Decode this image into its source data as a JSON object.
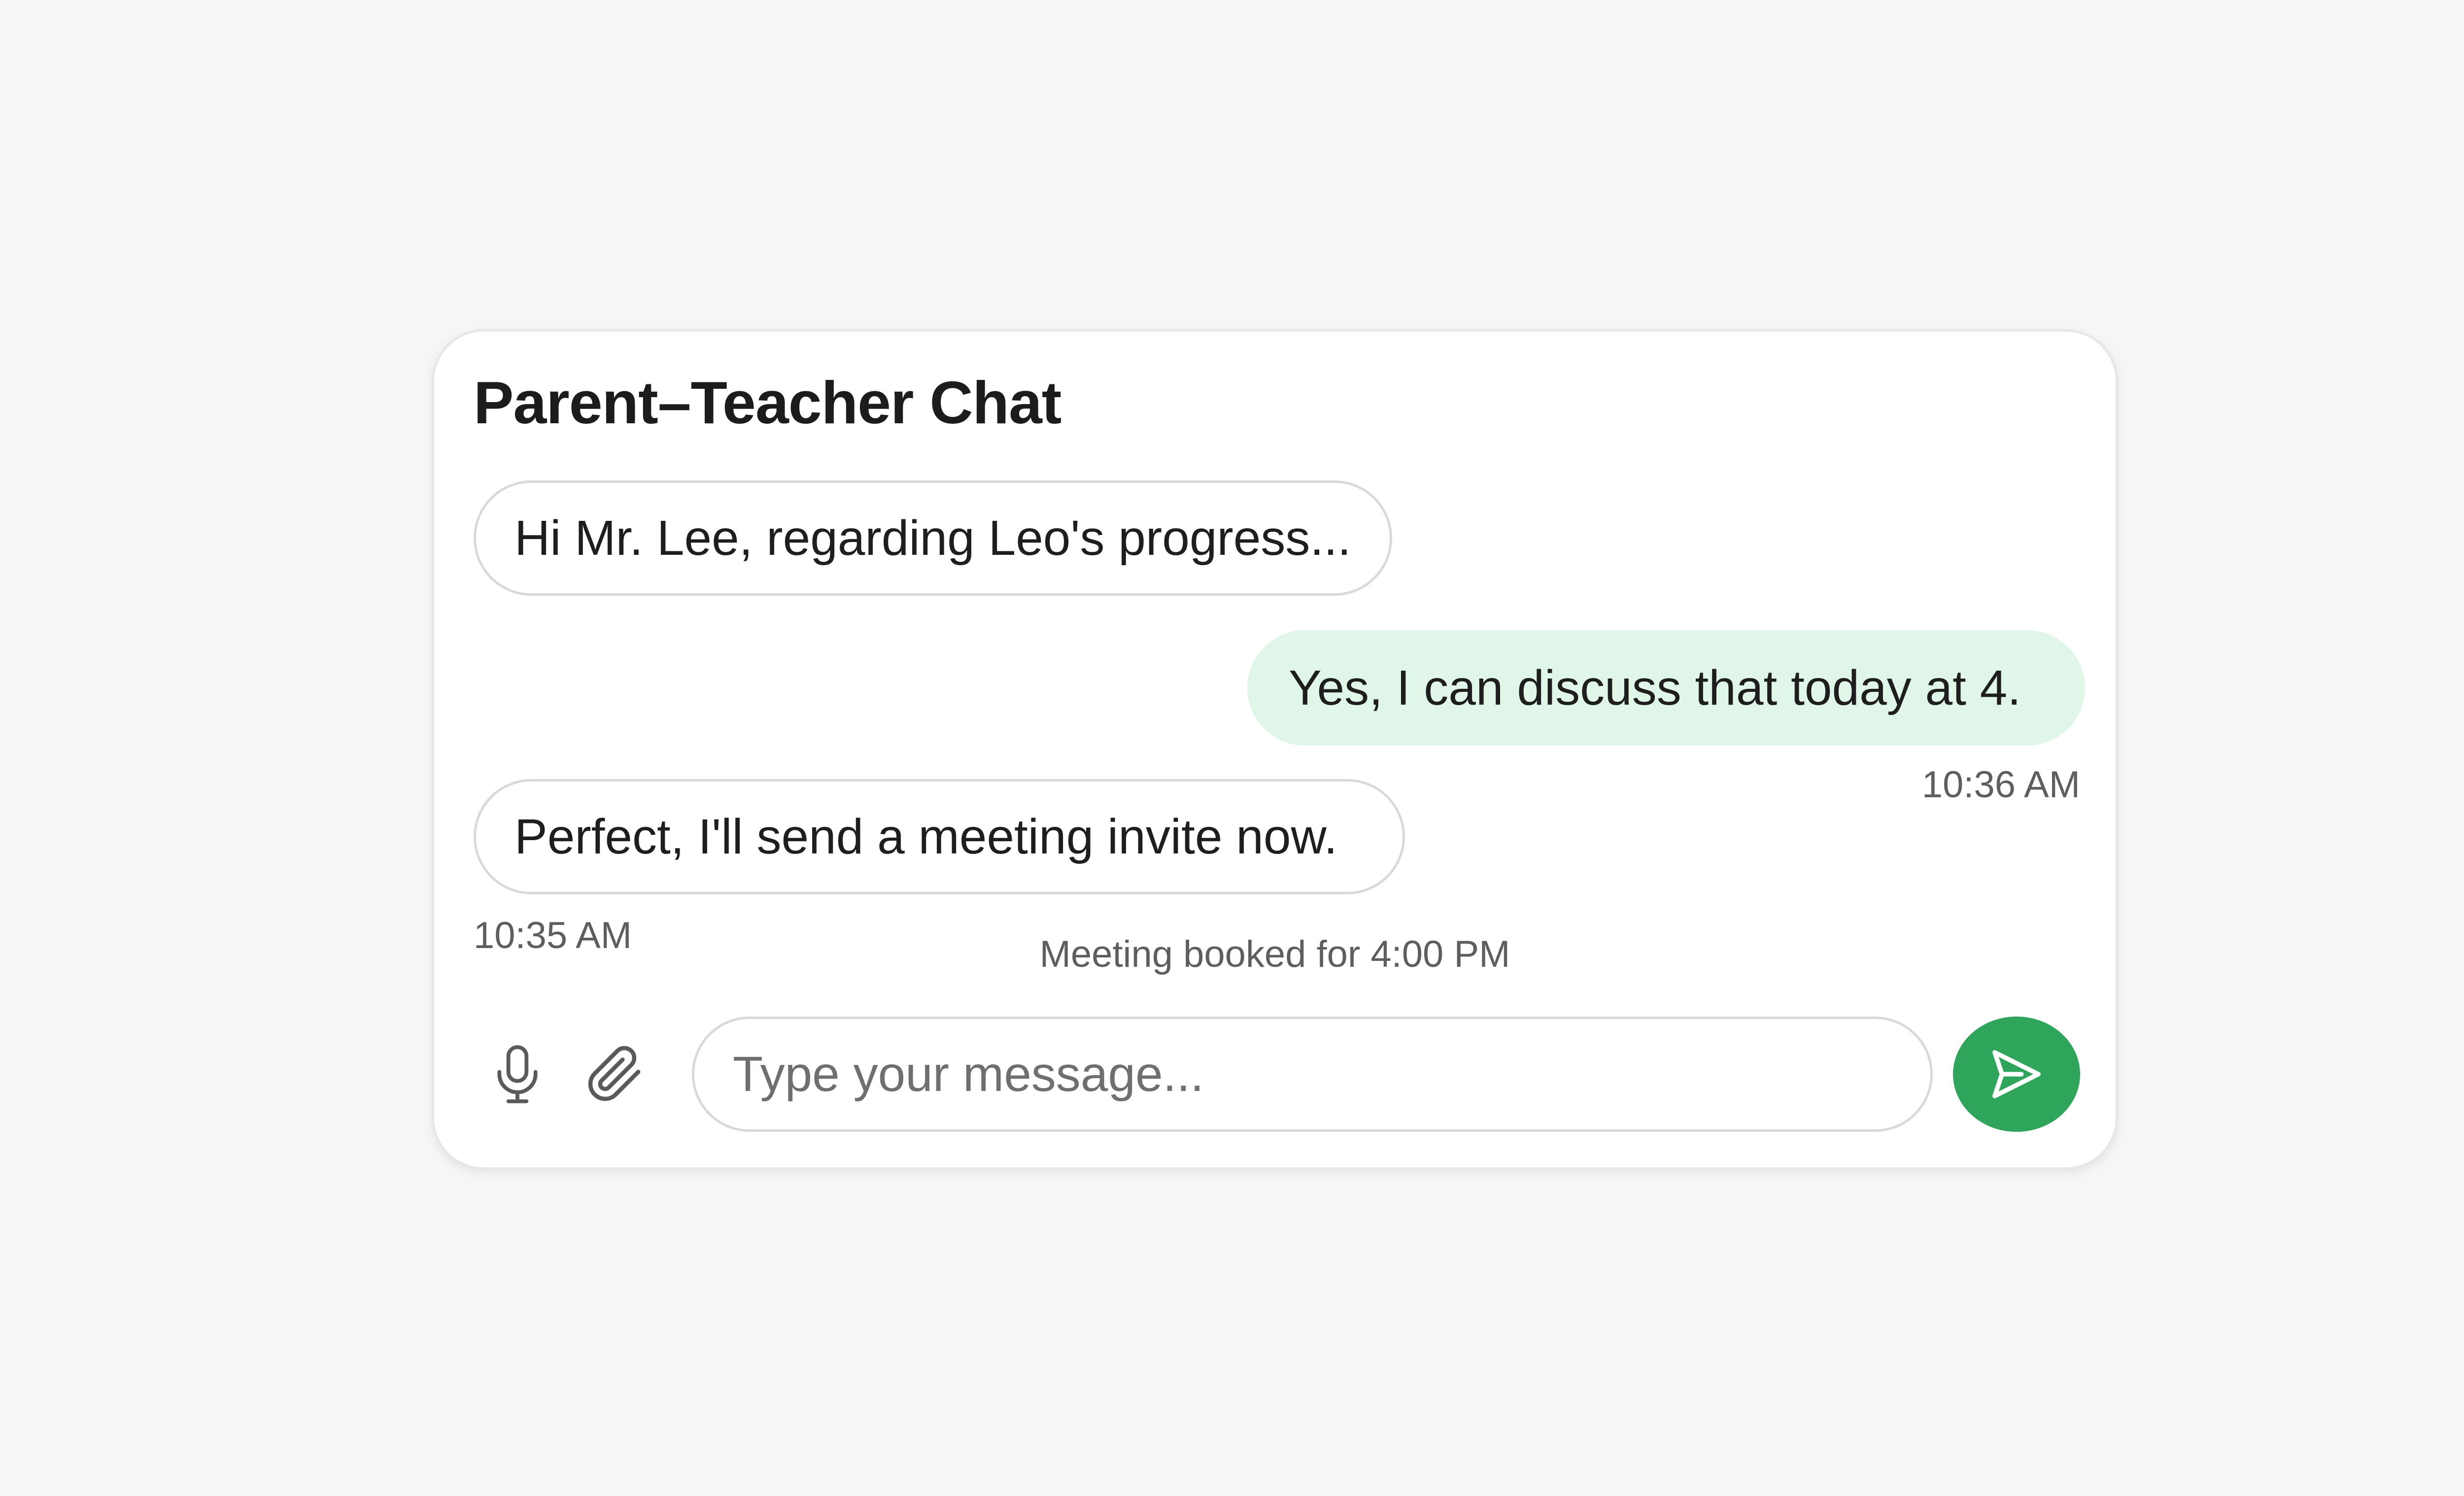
{
  "header": {
    "title": "Parent–Teacher Chat"
  },
  "messages": [
    {
      "direction": "incoming",
      "text": "Hi Mr. Lee, regarding Leo's progress...",
      "time": ""
    },
    {
      "direction": "outgoing",
      "text": "Yes, I can discuss that today at 4.",
      "time": "10:36 AM"
    },
    {
      "direction": "incoming",
      "text": "Perfect, I'll send a meeting invite now.",
      "time": "10:35 AM"
    }
  ],
  "system_note": "Meeting booked for 4:00 PM",
  "composer": {
    "placeholder": "Type your message...",
    "value": "",
    "mic_icon": "microphone-icon",
    "attach_icon": "paperclip-icon",
    "send_icon": "send-icon"
  },
  "colors": {
    "background": "#f6f6f6",
    "card": "#ffffff",
    "outgoing_bubble": "#dff6e9",
    "send_button": "#2fa55c",
    "border": "#d9d9d9"
  }
}
